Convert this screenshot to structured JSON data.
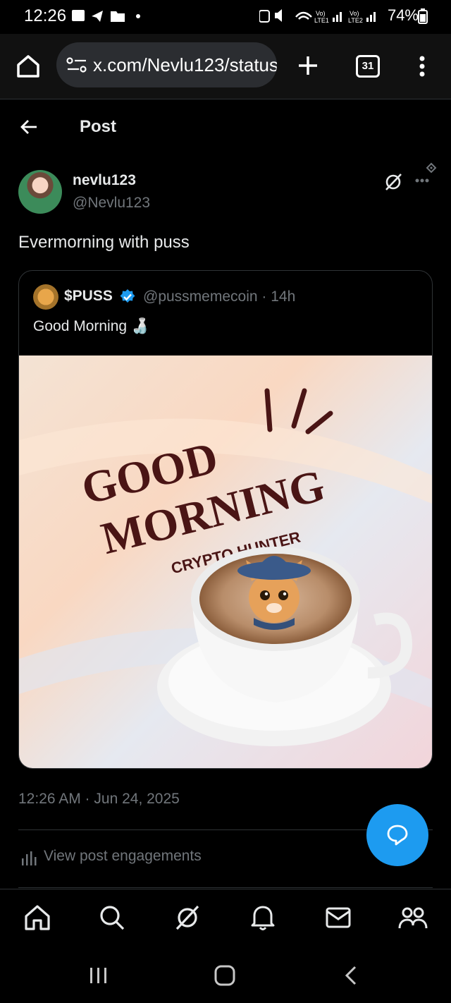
{
  "status_bar": {
    "time": "12:26",
    "battery": "74%"
  },
  "browser": {
    "url": "x.com/Nevlu123/status/",
    "tab_count": "31"
  },
  "header": {
    "title": "Post"
  },
  "post": {
    "display_name": "nevlu123",
    "handle": "@Nevlu123",
    "text": "Evermorning with puss",
    "timestamp": "12:26 AM · Jun 24, 2025",
    "engagements_label": "View post engagements"
  },
  "quote": {
    "name": "$PUSS",
    "handle_time": "@pussmemecoin · 14h",
    "text": "Good Morning 🍶",
    "image": {
      "line1": "GOOD",
      "line2": "MORNING",
      "line3": "CRYPTO HUNTER"
    }
  },
  "colors": {
    "accent": "#1d9bf0",
    "background": "#000000",
    "muted_text": "#71767b",
    "lettering": "#4a1515"
  },
  "icons": [
    "home-icon",
    "search-icon",
    "grok-icon",
    "bell-icon",
    "mail-icon",
    "communities-icon",
    "back-arrow-icon",
    "more-icon",
    "verified-badge-icon",
    "reply-icon",
    "analytics-icon"
  ]
}
